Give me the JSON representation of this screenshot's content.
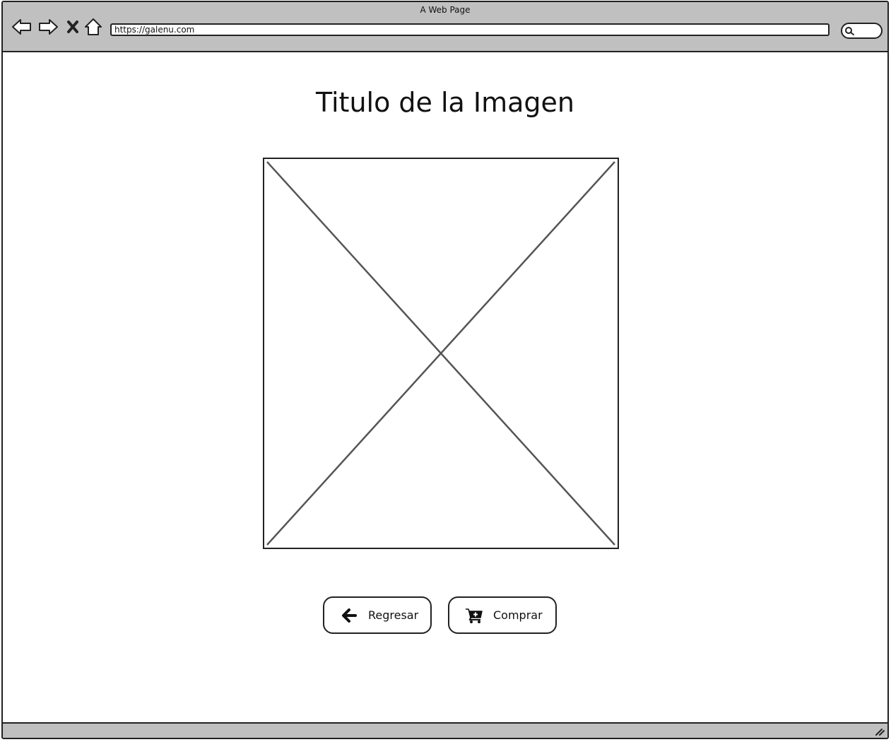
{
  "window": {
    "title": "A Web Page"
  },
  "toolbar": {
    "icons": [
      "back-icon",
      "forward-icon",
      "close-icon",
      "home-icon"
    ],
    "url": "https://galenu.com",
    "search_icon": "search-icon"
  },
  "main": {
    "title": "Titulo de la Imagen",
    "image_placeholder": "image-placeholder"
  },
  "buttons": {
    "back_label": "Regresar",
    "back_icon": "arrow-left-icon",
    "buy_label": "Comprar",
    "buy_icon": "cart-add-icon"
  }
}
